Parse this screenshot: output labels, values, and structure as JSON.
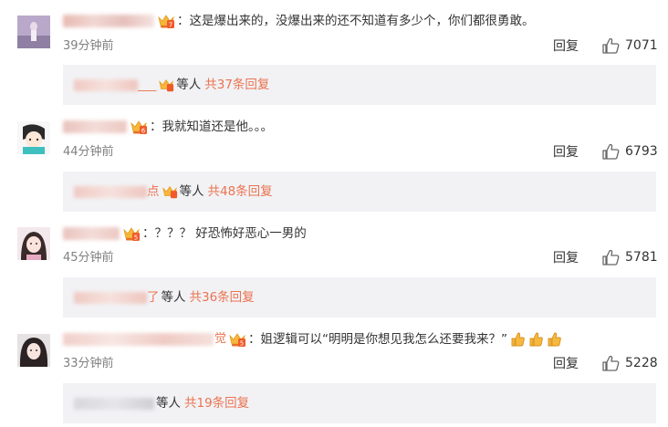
{
  "comments": [
    {
      "username_tail": "",
      "separator": "：",
      "text": "这是爆出来的，没爆出来的还不知道有多少个，你们都很勇敢。",
      "time": "39分钟前",
      "reply_label": "回复",
      "likes": "7071",
      "thread": {
        "name_tail": "___",
        "deng": "等人",
        "more": "共37条回复"
      }
    },
    {
      "username_tail": "",
      "separator": "：",
      "text": "我就知道还是他。。。",
      "time": "44分钟前",
      "reply_label": "回复",
      "likes": "6793",
      "thread": {
        "name_tail": "点",
        "deng": "等人",
        "more": "共48条回复"
      }
    },
    {
      "username_tail": "",
      "separator": "：",
      "text": "？？？ 好恐怖好恶心一男的",
      "time": "45分钟前",
      "reply_label": "回复",
      "likes": "5781",
      "thread": {
        "name_tail": "了",
        "deng": "等人",
        "more": "共36条回复"
      }
    },
    {
      "username_tail": "觉",
      "separator": "：",
      "text": "姐逻辑可以“明明是你想见我怎么还要我来？”",
      "time": "33分钟前",
      "reply_label": "回复",
      "likes": "5228",
      "emojis": [
        "thumbs-up",
        "thumbs-up",
        "thumbs-up"
      ],
      "thread": {
        "name_tail": "",
        "deng": "等人",
        "more": "共19条回复"
      }
    }
  ],
  "colors": {
    "accent": "#eb7350",
    "meta": "#808080",
    "reply_bg": "#f2f2f5"
  }
}
